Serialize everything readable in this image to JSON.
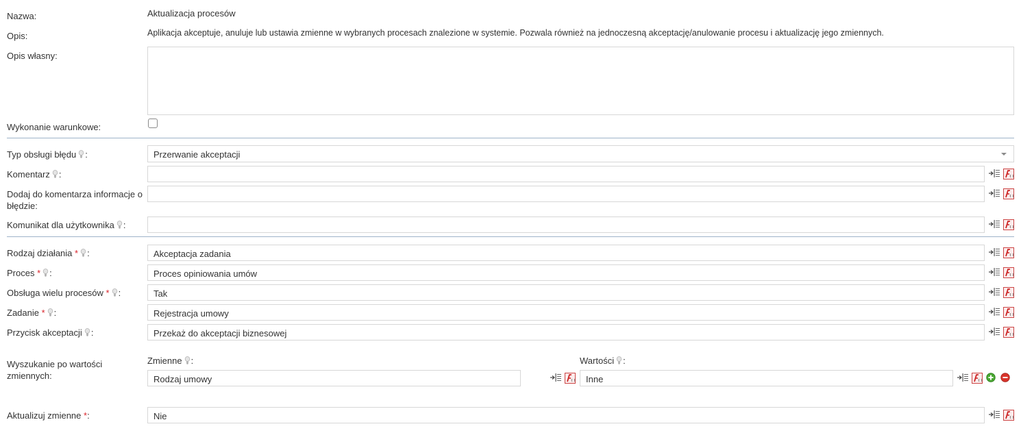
{
  "fields": {
    "nazwa": {
      "label": "Nazwa:",
      "value": "Aktualizacja procesów"
    },
    "opis": {
      "label": "Opis:",
      "value": "Aplikacja akceptuje, anuluje lub ustawia zmienne w wybranych procesach znalezione w systemie. Pozwala również na jednoczesną akceptację/anulowanie procesu i aktualizację jego zmiennych."
    },
    "opis_wlasny": {
      "label": "Opis własny:",
      "value": ""
    },
    "wykonanie_warunkowe": {
      "label": "Wykonanie warunkowe:",
      "checked": false
    }
  },
  "error_section": {
    "typ_obslugi": {
      "label": "Typ obsługi błędu",
      "value": "Przerwanie akceptacji"
    },
    "komentarz": {
      "label": "Komentarz",
      "value": ""
    },
    "dodaj_info": {
      "label_line1": "Dodaj do komentarza informacje o",
      "label_line2": "błędzie:",
      "value": ""
    },
    "komunikat": {
      "label": "Komunikat dla użytkownika",
      "value": ""
    }
  },
  "action_section": {
    "rodzaj": {
      "label": "Rodzaj działania",
      "value": "Akceptacja zadania"
    },
    "proces": {
      "label": "Proces",
      "value": "Proces opiniowania umów"
    },
    "obsluga": {
      "label": "Obsługa wielu procesów",
      "value": "Tak"
    },
    "zadanie": {
      "label": "Zadanie",
      "value": "Rejestracja umowy"
    },
    "przycisk": {
      "label": "Przycisk akceptacji",
      "value": "Przekaż do akceptacji biznesowej"
    },
    "wyszukanie": {
      "label_line1": "Wyszukanie po wartości",
      "label_line2": "zmiennych:",
      "zmienne_header": "Zmienne",
      "wartosci_header": "Wartości",
      "zmienne_value": "Rodzaj umowy",
      "wartosci_value": "Inne"
    },
    "aktualizuj": {
      "label": "Aktualizuj zmienne",
      "value": "Nie"
    }
  },
  "punct": {
    "colon": ":",
    "star": "*"
  },
  "icons": [
    "insert-variable-icon",
    "function-editor-icon",
    "add-row-icon",
    "remove-row-icon",
    "hint-bulb-icon",
    "dropdown-arrow-icon"
  ],
  "colors": {
    "required": "#d9242b",
    "divider": "#9eb3c9",
    "border": "#d7d7d7",
    "add": "#4aa832",
    "remove": "#d9342b"
  }
}
